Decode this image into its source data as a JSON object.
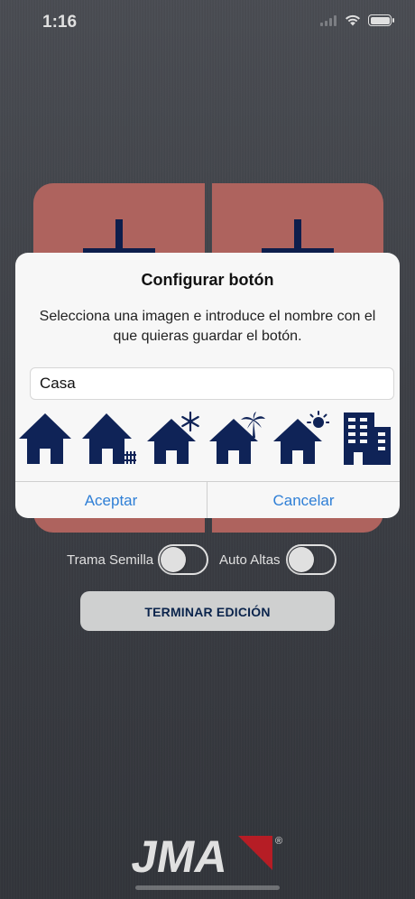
{
  "status_bar": {
    "time": "1:16",
    "icons": [
      "signal-icon",
      "wifi-icon",
      "battery-icon"
    ]
  },
  "remote": {
    "buttons": [
      {
        "position": "top-left",
        "icon": "plus-icon"
      },
      {
        "position": "top-right",
        "icon": "plus-icon"
      },
      {
        "position": "bottom-left",
        "icon": "plus-icon"
      },
      {
        "position": "bottom-right",
        "icon": "plus-icon"
      }
    ],
    "button_color": "#c7716b",
    "icon_color": "#0f2357"
  },
  "toggles": [
    {
      "label": "Trama Semilla",
      "on": false
    },
    {
      "label": "Auto Altas",
      "on": false
    }
  ],
  "end_button": {
    "label": "TERMINAR EDICIÓN"
  },
  "logo": {
    "text": "JMA",
    "icon": "jma-logo",
    "mark": "®",
    "accent_color": "#d0222b"
  },
  "dialog": {
    "title": "Configurar botón",
    "message": "Selecciona una imagen e introduce el nombre con el que quieras guardar el botón.",
    "input_value": "Casa",
    "icons": [
      "house-icon",
      "house-fence-icon",
      "house-snow-icon",
      "house-palm-icon",
      "house-sun-icon",
      "building-icon"
    ],
    "accept_label": "Aceptar",
    "cancel_label": "Cancelar",
    "link_color": "#2f7fd6"
  }
}
